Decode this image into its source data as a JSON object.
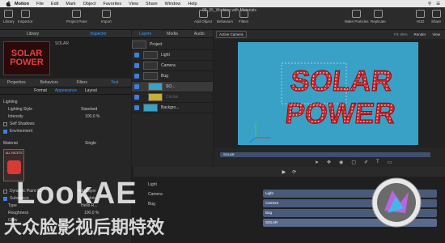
{
  "menubar": {
    "app": "Motion",
    "items": [
      "File",
      "Edit",
      "Mark",
      "Object",
      "Favorites",
      "View",
      "Share",
      "Window",
      "Help"
    ]
  },
  "window": {
    "title": "05_05_Working with Materials"
  },
  "toolbar": {
    "left": [
      "Library",
      "Inspector"
    ],
    "project_pane": "Project Pane",
    "import": "Import",
    "add_object": "Add Object",
    "behaviors": "Behaviors",
    "filters": "Filters",
    "make_particles": "Make Particles",
    "replicate": "Replicate",
    "hud": "HUD",
    "share": "Share"
  },
  "left_tabs": [
    "Library",
    "Inspector"
  ],
  "preview": {
    "title": "SOLAR",
    "line1": "SOLAR",
    "line2": "POWER"
  },
  "inspector_tabs": [
    "Properties",
    "Behaviors",
    "Filters",
    "Text"
  ],
  "inspector_subtabs": [
    "Format",
    "Appearance",
    "Layout"
  ],
  "lighting": {
    "header": "Lighting",
    "style_label": "Lighting Style",
    "style_value": "Standard",
    "intensity_label": "Intensity",
    "intensity_value": "100.0 %",
    "self_shadows": "Self Shadows",
    "environment": "Environment"
  },
  "material": {
    "header": "Material",
    "value": "Single",
    "swatch_name": "ALL FACETS"
  },
  "lower_inspector": {
    "add_layer": "Add Layer",
    "rows": [
      {
        "label": "Dynamic Paint 01",
        "value": ""
      },
      {
        "label": "Substance",
        "value": "Fabric"
      },
      {
        "label": "Type",
        "value": "Hello R..."
      },
      {
        "label": "Roughness",
        "value": "100.0 %"
      },
      {
        "label": "Glow",
        "value": ""
      }
    ]
  },
  "layers_tabs": [
    "Layers",
    "Media",
    "Audio"
  ],
  "layers": [
    {
      "name": "Project",
      "indent": 0
    },
    {
      "name": "Light",
      "indent": 1
    },
    {
      "name": "Camera",
      "indent": 1
    },
    {
      "name": "Bug",
      "indent": 1
    },
    {
      "name": "SO...",
      "indent": 2
    },
    {
      "name": "Circles",
      "indent": 2
    },
    {
      "name": "Backgro...",
      "indent": 1
    }
  ],
  "canvas": {
    "camera_menu": "Active Camera",
    "fit": "Fit: 65%",
    "render": "Render",
    "view": "View",
    "title_line1": "SOLAR",
    "title_line2": "POWER",
    "track_label": "SOLAR"
  },
  "timeline": {
    "tracks": [
      "Light",
      "Camera",
      "Bug",
      "SOLAR"
    ],
    "left_rows": [
      "Light",
      "Camera",
      "Bug"
    ]
  },
  "watermark": {
    "line1": "LookAE",
    "line2": "大众脸影视后期特效"
  }
}
